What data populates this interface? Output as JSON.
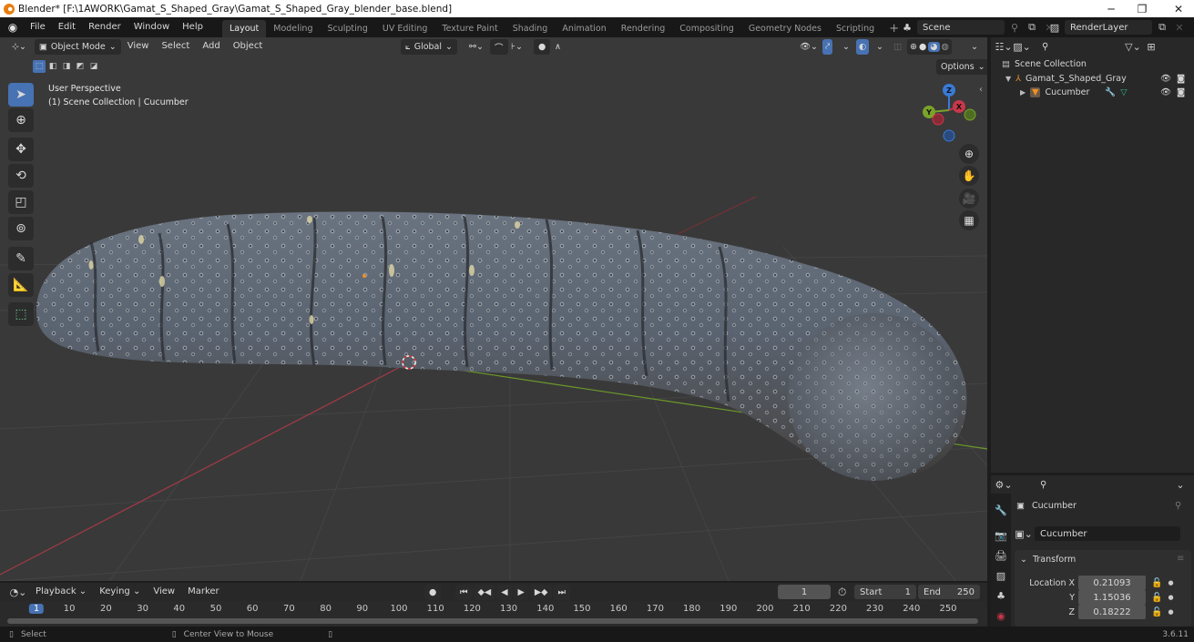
{
  "window": {
    "title": "Blender* [F:\\1AWORK\\Gamat_S_Shaped_Gray\\Gamat_S_Shaped_Gray_blender_base.blend]",
    "minimize": "─",
    "maximize": "❐",
    "close": "✕"
  },
  "menu": {
    "items": [
      "File",
      "Edit",
      "Render",
      "Window",
      "Help"
    ]
  },
  "workspaces": {
    "tabs": [
      "Layout",
      "Modeling",
      "Sculpting",
      "UV Editing",
      "Texture Paint",
      "Shading",
      "Animation",
      "Rendering",
      "Compositing",
      "Geometry Nodes",
      "Scripting"
    ],
    "active": "Layout",
    "add": "+"
  },
  "scene": {
    "name": "Scene",
    "view_layer": "RenderLayer"
  },
  "viewport_header": {
    "mode": "Object Mode",
    "menus": [
      "View",
      "Select",
      "Add",
      "Object"
    ],
    "transform_orientation": "Global",
    "options_label": "Options"
  },
  "viewport": {
    "perspective_label": "User Perspective",
    "collection_label": "(1) Scene Collection | Cucumber",
    "gizmo": {
      "z": "Z",
      "y": "Y",
      "x": "X"
    },
    "colors": {
      "x_axis": "#c8374a",
      "y_axis": "#7aa32a",
      "z_axis": "#3a7ad6",
      "grid_line": "#454545",
      "object_body": "#5b6470"
    }
  },
  "outliner": {
    "root": "Scene Collection",
    "items": [
      {
        "name": "Gamat_S_Shaped_Gray",
        "type": "collection-armature",
        "level": 1
      },
      {
        "name": "Cucumber",
        "type": "mesh-object",
        "level": 2
      }
    ]
  },
  "properties": {
    "object_name": "Cucumber",
    "data_name": "Cucumber",
    "panel": "Transform",
    "location": [
      {
        "label": "Location X",
        "value": "0.21093"
      },
      {
        "label": "Y",
        "value": "1.15036"
      },
      {
        "label": "Z",
        "value": "0.18222"
      }
    ]
  },
  "timeline": {
    "menus": [
      "Playback",
      "Keying",
      "View",
      "Marker"
    ],
    "current_frame": "1",
    "start_label": "Start",
    "start": "1",
    "end_label": "End",
    "end": "250",
    "ticks": [
      "1",
      "10",
      "20",
      "30",
      "40",
      "50",
      "60",
      "70",
      "80",
      "90",
      "100",
      "110",
      "120",
      "130",
      "140",
      "150",
      "160",
      "170",
      "180",
      "190",
      "200",
      "210",
      "220",
      "230",
      "240",
      "250"
    ]
  },
  "status": {
    "hints": [
      "Select",
      "Center View to Mouse"
    ],
    "version": "3.6.11"
  }
}
